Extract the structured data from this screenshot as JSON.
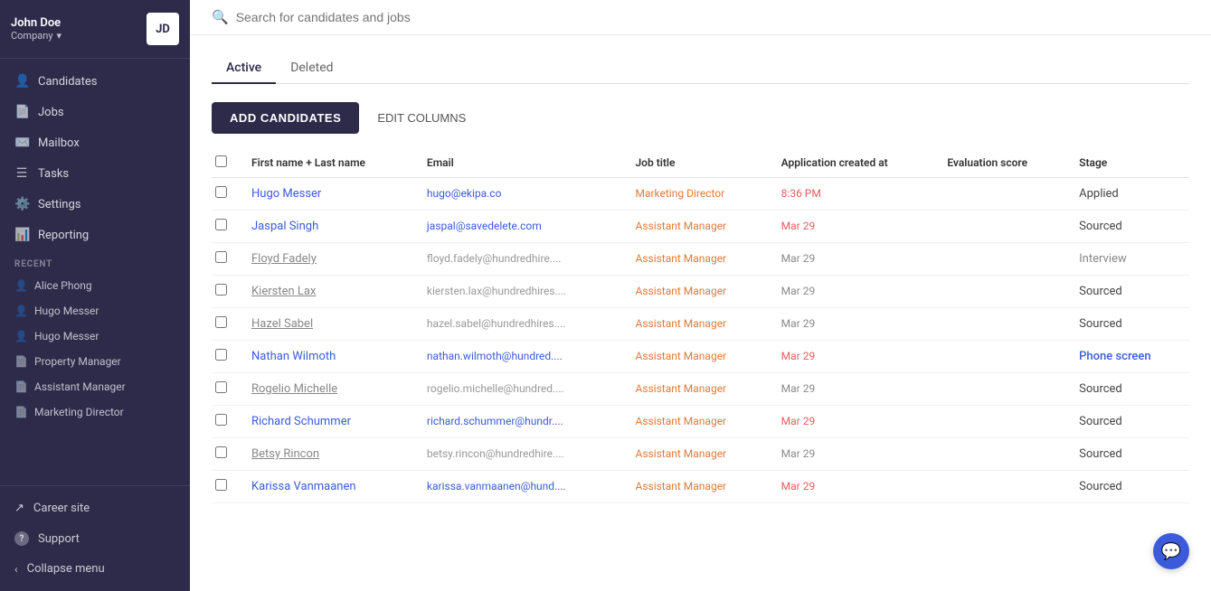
{
  "sidebar": {
    "company_name": "John Doe",
    "company_sub": "Company",
    "avatar_initials": "JD",
    "nav_items": [
      {
        "id": "candidates",
        "label": "Candidates",
        "icon": "👤"
      },
      {
        "id": "jobs",
        "label": "Jobs",
        "icon": "📄"
      },
      {
        "id": "mailbox",
        "label": "Mailbox",
        "icon": "✉️"
      },
      {
        "id": "tasks",
        "label": "Tasks",
        "icon": "☰"
      },
      {
        "id": "settings",
        "label": "Settings",
        "icon": "⚙️"
      },
      {
        "id": "reporting",
        "label": "Reporting",
        "icon": "📊"
      }
    ],
    "recent_label": "RECENT",
    "recent_items": [
      {
        "id": "alice-phong",
        "label": "Alice Phong",
        "icon": "👤"
      },
      {
        "id": "hugo-messer-1",
        "label": "Hugo Messer",
        "icon": "👤"
      },
      {
        "id": "hugo-messer-2",
        "label": "Hugo Messer",
        "icon": "👤"
      },
      {
        "id": "property-manager",
        "label": "Property Manager",
        "icon": "📄"
      },
      {
        "id": "assistant-manager",
        "label": "Assistant Manager",
        "icon": "📄"
      },
      {
        "id": "marketing-director",
        "label": "Marketing Director",
        "icon": "📄"
      }
    ],
    "footer_items": [
      {
        "id": "career-site",
        "label": "Career site",
        "icon": "↗"
      },
      {
        "id": "support",
        "label": "Support",
        "icon": "?"
      },
      {
        "id": "collapse-menu",
        "label": "Collapse menu",
        "icon": "‹"
      }
    ]
  },
  "topbar": {
    "search_placeholder": "Search for candidates and jobs"
  },
  "tabs": [
    {
      "id": "active",
      "label": "Active",
      "active": true
    },
    {
      "id": "deleted",
      "label": "Deleted",
      "active": false
    }
  ],
  "actions": {
    "add_candidates_label": "ADD CANDIDATES",
    "edit_columns_label": "EDIT COLUMNS"
  },
  "table": {
    "headers": [
      {
        "id": "name",
        "label": "First name + Last name"
      },
      {
        "id": "email",
        "label": "Email"
      },
      {
        "id": "job_title",
        "label": "Job title"
      },
      {
        "id": "created_at",
        "label": "Application created at"
      },
      {
        "id": "eval_score",
        "label": "Evaluation score"
      },
      {
        "id": "stage",
        "label": "Stage"
      }
    ],
    "rows": [
      {
        "id": 1,
        "name": "Hugo Messer",
        "name_style": "link",
        "email": "hugo@ekipa.co",
        "email_style": "link",
        "job_title": "Marketing Director",
        "created_at": "8:36 PM",
        "date_style": "red",
        "eval_score": "",
        "stage": "Applied",
        "stage_style": "normal"
      },
      {
        "id": 2,
        "name": "Jaspal Singh",
        "name_style": "link",
        "email": "jaspal@savedelete.com",
        "email_style": "link",
        "job_title": "Assistant Manager",
        "created_at": "Mar 29",
        "date_style": "red",
        "eval_score": "",
        "stage": "Sourced",
        "stage_style": "normal"
      },
      {
        "id": 3,
        "name": "Floyd Fadely",
        "name_style": "muted",
        "email": "floyd.fadely@hundredhire....",
        "email_style": "muted",
        "job_title": "Assistant Manager",
        "created_at": "Mar 29",
        "date_style": "muted",
        "eval_score": "",
        "stage": "Interview",
        "stage_style": "muted"
      },
      {
        "id": 4,
        "name": "Kiersten Lax",
        "name_style": "muted",
        "email": "kiersten.lax@hundredhires....",
        "email_style": "muted",
        "job_title": "Assistant Manager",
        "created_at": "Mar 29",
        "date_style": "muted",
        "eval_score": "",
        "stage": "Sourced",
        "stage_style": "normal"
      },
      {
        "id": 5,
        "name": "Hazel Sabel",
        "name_style": "muted",
        "email": "hazel.sabel@hundredhires....",
        "email_style": "muted",
        "job_title": "Assistant Manager",
        "created_at": "Mar 29",
        "date_style": "muted",
        "eval_score": "",
        "stage": "Sourced",
        "stage_style": "normal"
      },
      {
        "id": 6,
        "name": "Nathan Wilmoth",
        "name_style": "link",
        "email": "nathan.wilmoth@hundred....",
        "email_style": "link",
        "job_title": "Assistant Manager",
        "created_at": "Mar 29",
        "date_style": "red",
        "eval_score": "",
        "stage": "Phone screen",
        "stage_style": "phonescreen"
      },
      {
        "id": 7,
        "name": "Rogelio Michelle",
        "name_style": "muted",
        "email": "rogelio.michelle@hundred....",
        "email_style": "muted",
        "job_title": "Assistant Manager",
        "created_at": "Mar 29",
        "date_style": "muted",
        "eval_score": "",
        "stage": "Sourced",
        "stage_style": "normal"
      },
      {
        "id": 8,
        "name": "Richard Schummer",
        "name_style": "link",
        "email": "richard.schummer@hundr....",
        "email_style": "link",
        "job_title": "Assistant Manager",
        "created_at": "Mar 29",
        "date_style": "red",
        "eval_score": "",
        "stage": "Sourced",
        "stage_style": "normal"
      },
      {
        "id": 9,
        "name": "Betsy Rincon",
        "name_style": "muted",
        "email": "betsy.rincon@hundredhire....",
        "email_style": "muted",
        "job_title": "Assistant Manager",
        "created_at": "Mar 29",
        "date_style": "muted",
        "eval_score": "",
        "stage": "Sourced",
        "stage_style": "normal"
      },
      {
        "id": 10,
        "name": "Karissa Vanmaanen",
        "name_style": "link",
        "email": "karissa.vanmaanen@hund....",
        "email_style": "link",
        "job_title": "Assistant Manager",
        "created_at": "Mar 29",
        "date_style": "red",
        "eval_score": "",
        "stage": "Sourced",
        "stage_style": "normal"
      }
    ]
  }
}
